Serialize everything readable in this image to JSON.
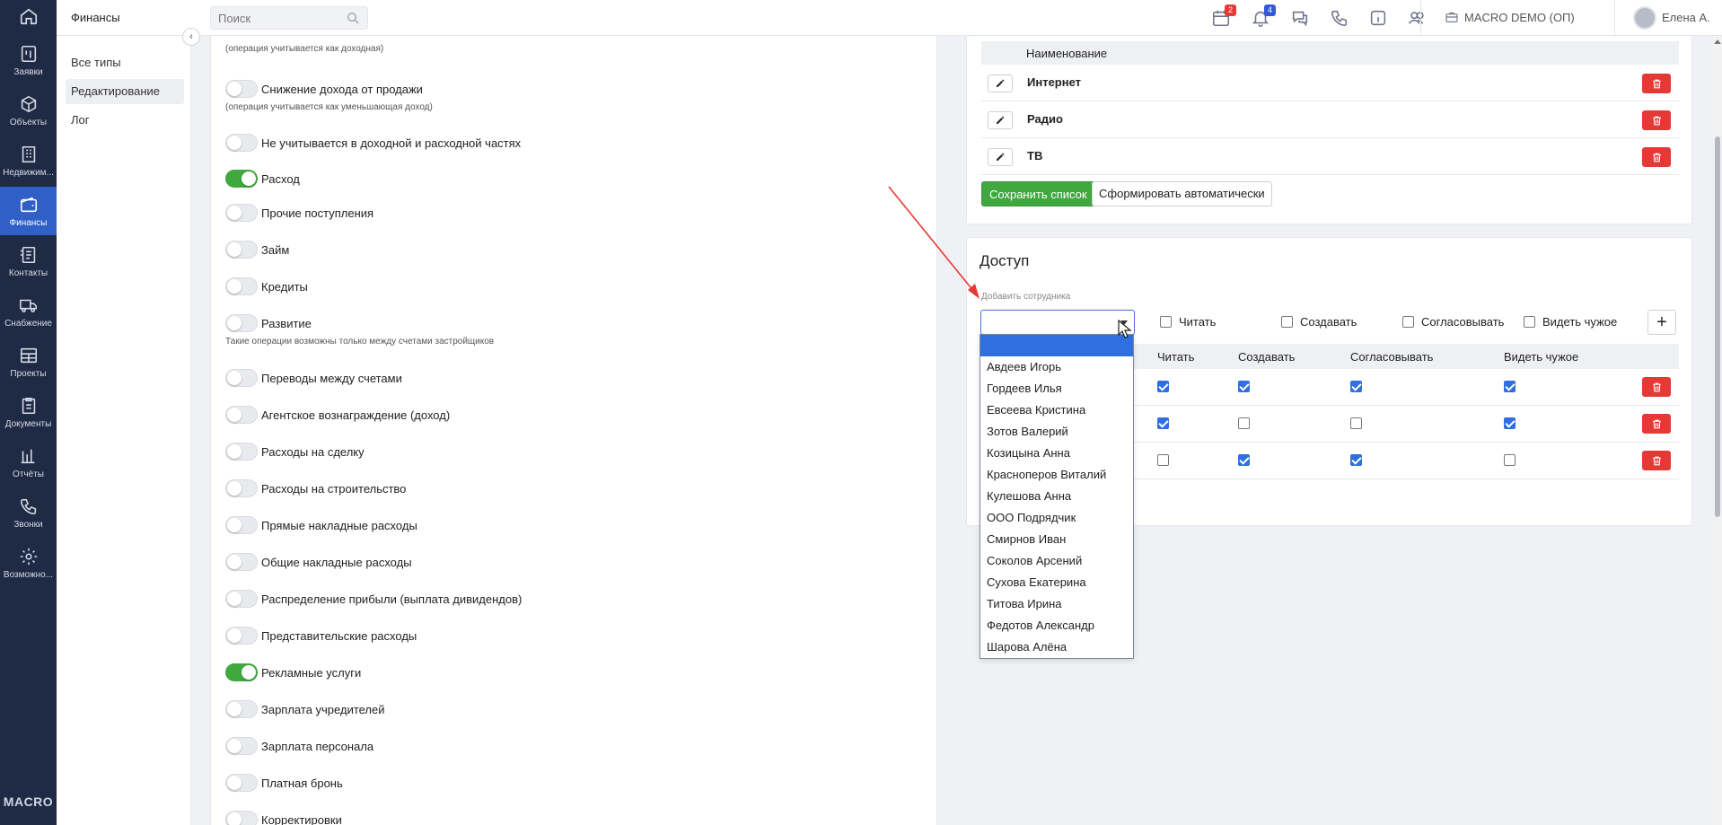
{
  "rail": {
    "items": [
      {
        "label": "Заявки",
        "icon": "requests-icon"
      },
      {
        "label": "Объекты",
        "icon": "cube-icon"
      },
      {
        "label": "Недвижим...",
        "icon": "building-icon"
      },
      {
        "label": "Финансы",
        "icon": "wallet-icon",
        "active": true
      },
      {
        "label": "Контакты",
        "icon": "contacts-icon"
      },
      {
        "label": "Снабжение",
        "icon": "truck-icon"
      },
      {
        "label": "Проекты",
        "icon": "projects-icon"
      },
      {
        "label": "Документы",
        "icon": "clipboard-icon"
      },
      {
        "label": "Отчёты",
        "icon": "chart-icon"
      },
      {
        "label": "Звонки",
        "icon": "phone-icon"
      },
      {
        "label": "Возможно...",
        "icon": "gear-icon"
      }
    ],
    "logo": "MACRO"
  },
  "topbar": {
    "section": "Финансы",
    "search_placeholder": "Поиск",
    "calendar_badge": "2",
    "notifications_badge": "4",
    "company": "MACRO DEMO (ОП)",
    "user_name": "Елена А."
  },
  "subnav": {
    "items": [
      "Все типы",
      "Редактирование",
      "Лог"
    ],
    "active_index": 1
  },
  "left_panel": {
    "top_note": "(операция учитывается как доходная)",
    "rows": [
      {
        "label": "Снижение дохода от продажи",
        "on": false,
        "note": "(операция учитывается как уменьшающая доход)"
      },
      {
        "label": "Не учитывается в доходной и расходной частях",
        "on": false
      },
      {
        "label": "Расход",
        "on": true
      },
      {
        "label": "Прочие поступления",
        "on": false
      },
      {
        "label": "Займ",
        "on": false
      },
      {
        "label": "Кредиты",
        "on": false
      },
      {
        "label": "Развитие",
        "on": false,
        "note": "Такие операции возможны только между счетами застройщиков"
      },
      {
        "label": "Переводы между счетами",
        "on": false
      },
      {
        "label": "Агентское вознаграждение (доход)",
        "on": false
      },
      {
        "label": "Расходы на сделку",
        "on": false
      },
      {
        "label": "Расходы на строительство",
        "on": false
      },
      {
        "label": "Прямые накладные расходы",
        "on": false
      },
      {
        "label": "Общие накладные расходы",
        "on": false
      },
      {
        "label": "Распределение прибыли (выплата дивидендов)",
        "on": false
      },
      {
        "label": "Представительские расходы",
        "on": false
      },
      {
        "label": "Рекламные услуги",
        "on": true
      },
      {
        "label": "Зарплата учредителей",
        "on": false
      },
      {
        "label": "Зарплата персонала",
        "on": false
      },
      {
        "label": "Платная бронь",
        "on": false
      },
      {
        "label": "Корректировки",
        "on": false
      }
    ]
  },
  "list_card": {
    "column_header": "Наименование",
    "rows": [
      "Интернет",
      "Радио",
      "ТВ"
    ],
    "save_label": "Сохранить список",
    "auto_label": "Сформировать автоматически"
  },
  "access_card": {
    "title": "Доступ",
    "add_employee_label": "Добавить сотрудника",
    "select_value": "",
    "permission_labels": [
      "Читать",
      "Создавать",
      "Согласовывать",
      "Видеть чужое"
    ],
    "permission_checked": [
      false,
      false,
      false,
      false
    ],
    "plus_label": "+",
    "table_headers": [
      "Читать",
      "Создавать",
      "Согласовывать",
      "Видеть чужое"
    ],
    "rows": [
      {
        "read": true,
        "create": true,
        "approve": true,
        "see_others": true
      },
      {
        "read": true,
        "create": false,
        "approve": false,
        "see_others": true
      },
      {
        "read": false,
        "create": true,
        "approve": true,
        "see_others": false
      }
    ]
  },
  "dropdown": {
    "options": [
      "",
      "Авдеев Игорь",
      "Гордеев Илья",
      "Евсеева Кристина",
      "Зотов Валерий",
      "Козицына Анна",
      "Красноперов Виталий",
      "Кулешова Анна",
      "ООО Подрядчик",
      "Смирнов Иван",
      "Соколов Арсений",
      "Сухова Екатерина",
      "Титова Ирина",
      "Федотов Александр",
      "Шарова Алёна"
    ],
    "selected_index": 0
  },
  "colors": {
    "rail_bg": "#1f2a44",
    "rail_active": "#2f5fc7",
    "toggle_on": "#3fa93f",
    "delete": "#e53935",
    "save": "#3fa93f",
    "select_highlight": "#2f6fe0",
    "annotation_arrow": "#e53935"
  }
}
